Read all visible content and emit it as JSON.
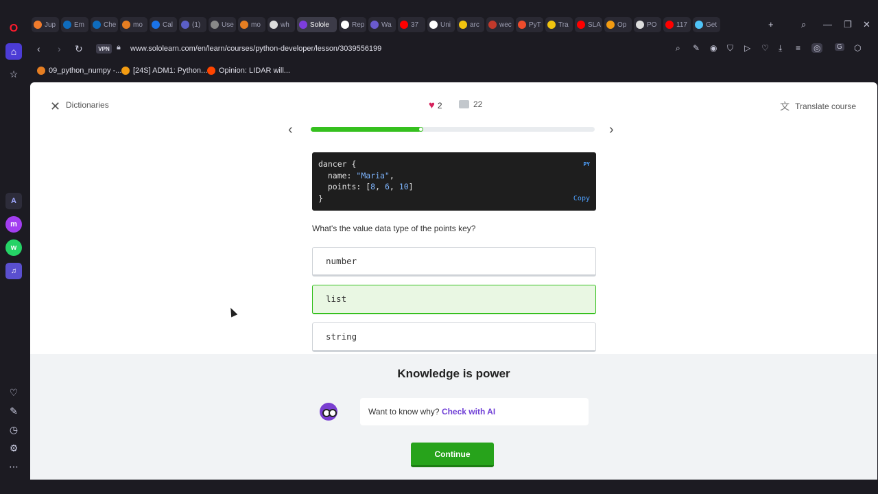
{
  "tabs": [
    {
      "label": "Jup",
      "color": "#f07b2c"
    },
    {
      "label": "Em",
      "color": "#0f6cbd"
    },
    {
      "label": "Che",
      "color": "#0f6cbd"
    },
    {
      "label": "mo",
      "color": "#e67e22"
    },
    {
      "label": "Cal",
      "color": "#1a73e8"
    },
    {
      "label": "(1)",
      "color": "#5b5fc7"
    },
    {
      "label": "Use",
      "color": "#888888"
    },
    {
      "label": "mo",
      "color": "#e67e22"
    },
    {
      "label": "wh",
      "color": "#dddddd"
    },
    {
      "label": "Solole",
      "color": "#7d3ddc"
    },
    {
      "label": "Rep",
      "color": "#ffffff"
    },
    {
      "label": "Wa",
      "color": "#6a5acd"
    },
    {
      "label": "37",
      "color": "#ff0000"
    },
    {
      "label": "Uni",
      "color": "#ffffff"
    },
    {
      "label": "arc",
      "color": "#f1c40f"
    },
    {
      "label": "wec",
      "color": "#c0392b"
    },
    {
      "label": "PyT",
      "color": "#ee4c2c"
    },
    {
      "label": "Tra",
      "color": "#f1c40f"
    },
    {
      "label": "SLA",
      "color": "#ff0000"
    },
    {
      "label": "Op",
      "color": "#f39c12"
    },
    {
      "label": "PO",
      "color": "#dddddd"
    },
    {
      "label": "117",
      "color": "#ff0000"
    },
    {
      "label": "Get",
      "color": "#4fc3f7"
    }
  ],
  "browser": {
    "vpn_label": "VPN",
    "url": "www.sololearn.com/en/learn/courses/python-developer/lesson/3039556199"
  },
  "bookmarks": [
    {
      "label": "09_python_numpy -...",
      "color": "#e67e22"
    },
    {
      "label": "[24S] ADM1: Python...",
      "color": "#f39c12"
    },
    {
      "label": "Opinion: LIDAR will...",
      "color": "#ff4500"
    }
  ],
  "lesson": {
    "title": "Dictionaries",
    "hearts": "2",
    "comments": "22",
    "translate_label": "Translate course",
    "progress_fraction": 0.39
  },
  "code": {
    "lang": "PY",
    "copy_label": "Copy",
    "line1": "dancer {",
    "line2_key": "  name: ",
    "line2_val": "\"Maria\"",
    "line2_end": ",",
    "line3_key": "  points: [",
    "line3_v1": "8",
    "line3_sep1": ", ",
    "line3_v2": "6",
    "line3_sep2": ", ",
    "line3_v3": "10",
    "line3_end": "]",
    "line4": "}"
  },
  "question": "What's the value data type of the points key?",
  "options": [
    {
      "label": "number",
      "state": "default"
    },
    {
      "label": "list",
      "state": "correct"
    },
    {
      "label": "string",
      "state": "default"
    }
  ],
  "feedback": {
    "title": "Knowledge is power",
    "ai_prompt": "Want to know why? ",
    "ai_link": "Check with AI",
    "continue_label": "Continue"
  },
  "colors": {
    "accent_green": "#35c01e",
    "continue_green": "#27a31b",
    "ai_purple": "#6f3fd6"
  }
}
